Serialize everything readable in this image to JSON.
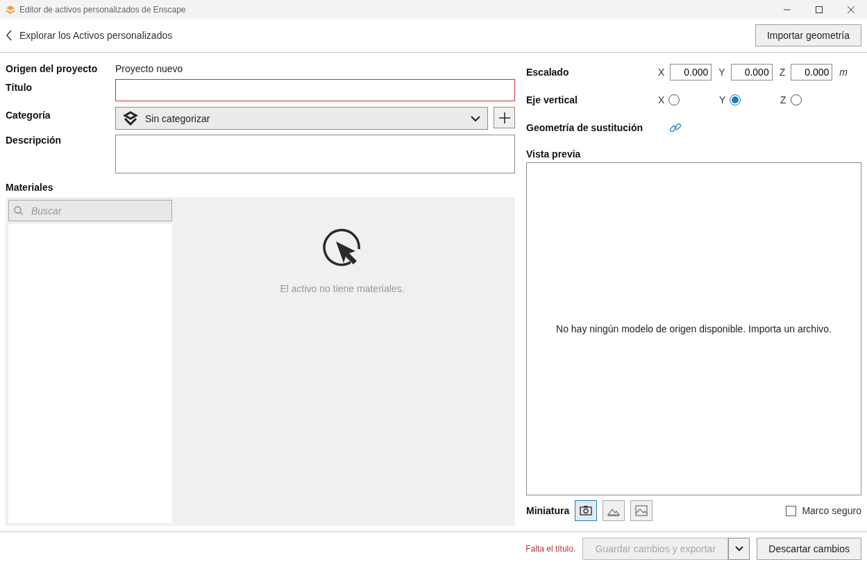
{
  "window": {
    "title": "Editor de activos personalizados de Enscape"
  },
  "header": {
    "back_link": "Explorar los Activos personalizados",
    "import_button": "Importar geometría"
  },
  "form": {
    "origin": {
      "label": "Origen del proyecto",
      "value": "Proyecto nuevo"
    },
    "title": {
      "label": "Título",
      "invalid": true
    },
    "category": {
      "label": "Categoría",
      "value": "Sin categorizar"
    },
    "description": {
      "label": "Descripción"
    }
  },
  "materials": {
    "label": "Materiales",
    "search_placeholder": "Buscar",
    "empty_message": "El activo no tiene materiales."
  },
  "scaling": {
    "label": "Escalado",
    "axes": [
      {
        "axis": "X",
        "value": "0.000"
      },
      {
        "axis": "Y",
        "value": "0.000"
      },
      {
        "axis": "Z",
        "value": "0.000"
      }
    ],
    "unit": "m"
  },
  "vertical_axis": {
    "label": "Eje vertical",
    "options": [
      {
        "label": "X",
        "selected": false
      },
      {
        "label": "Y",
        "selected": true
      },
      {
        "label": "Z",
        "selected": false
      }
    ]
  },
  "proxy_geometry": {
    "label": "Geometría de sustitución"
  },
  "preview": {
    "label": "Vista previa",
    "message": "No hay ningún modelo de origen disponible. Importa un archivo."
  },
  "thumbnail": {
    "label": "Miniatura",
    "modes": [
      {
        "kind": "camera",
        "selected": true
      },
      {
        "kind": "landscape",
        "selected": false
      },
      {
        "kind": "image",
        "selected": false
      }
    ],
    "safe_frame": {
      "label": "Marco seguro",
      "checked": false
    }
  },
  "footer": {
    "error": "Falta el título.",
    "save_button": {
      "label": "Guardar cambios y exportar",
      "disabled": true
    },
    "discard_button": "Descartar cambios"
  }
}
